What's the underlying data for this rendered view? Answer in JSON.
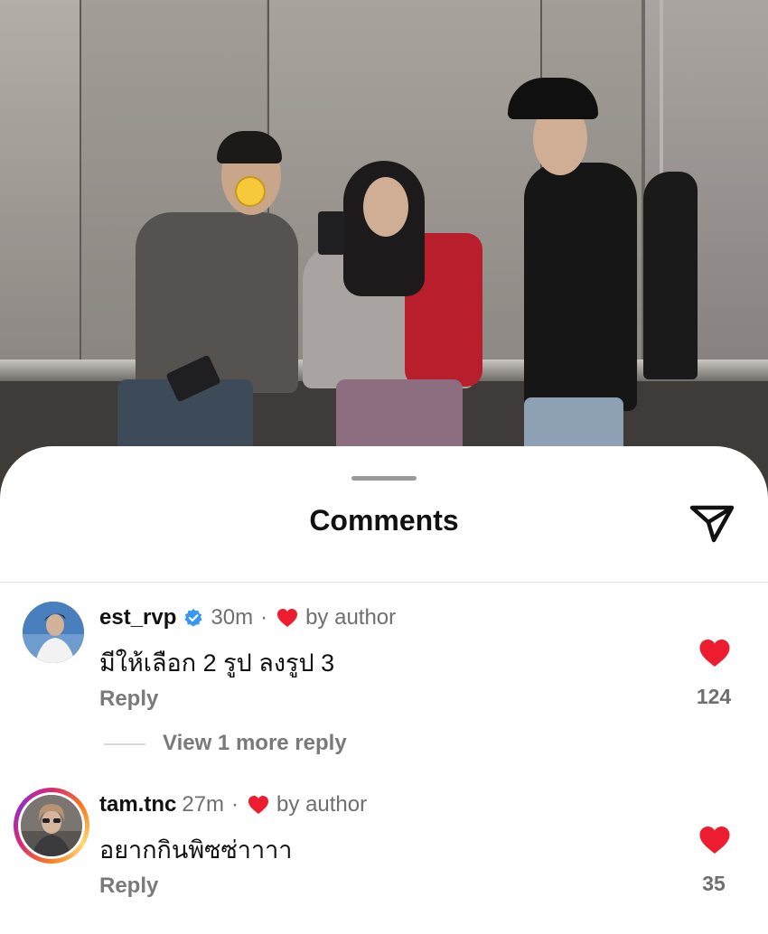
{
  "sheet": {
    "title": "Comments"
  },
  "comments": [
    {
      "username": "est_rvp",
      "verified": true,
      "time": "30m",
      "liked_by": "by author",
      "text": "มีให้เลือก 2 รูป ลงรูป 3",
      "reply_label": "Reply",
      "likes": "124",
      "view_more": "View 1 more reply"
    },
    {
      "username": "tam.tnc",
      "verified": false,
      "time": "27m",
      "liked_by": "by author",
      "text": "อยากกินพิซซ่าาาา",
      "reply_label": "Reply",
      "likes": "35"
    }
  ],
  "colors": {
    "heart": "#ed1c2f",
    "verified": "#3897f0",
    "text_primary": "#111111",
    "text_secondary": "#737373"
  },
  "icons": {
    "share": "paper-plane-icon",
    "like": "heart-icon",
    "verified": "verified-badge-icon"
  }
}
